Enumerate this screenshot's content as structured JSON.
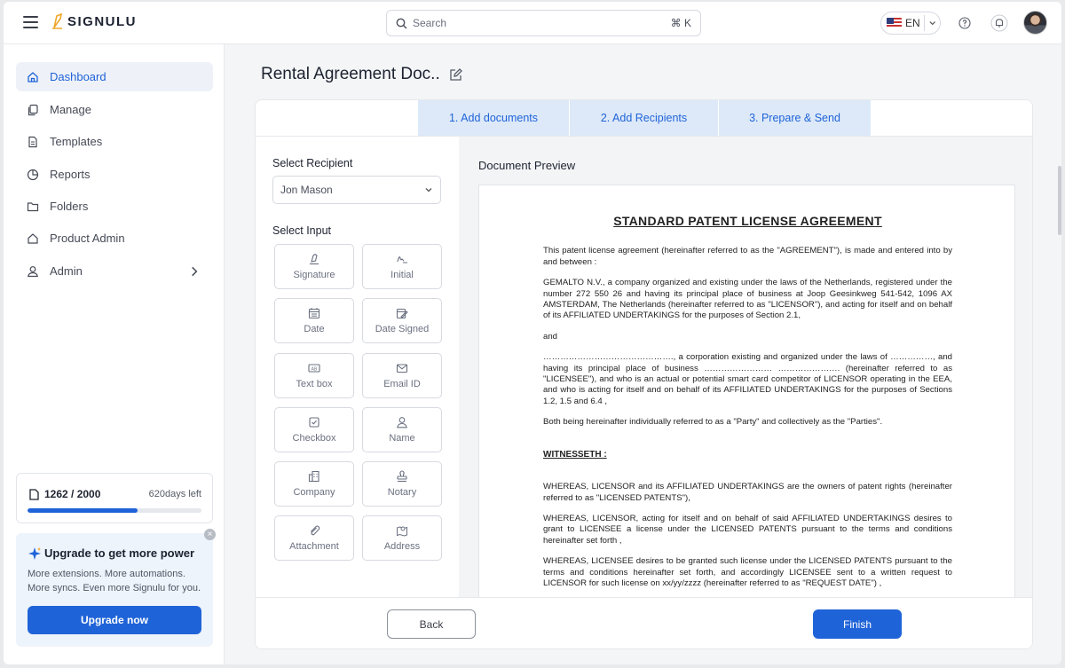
{
  "app": {
    "name": "SIGNULU"
  },
  "search": {
    "placeholder": "Search",
    "shortcut": "⌘ K"
  },
  "language": {
    "code": "EN"
  },
  "sidebar": {
    "items": [
      {
        "label": "Dashboard",
        "icon": "home-icon",
        "active": true
      },
      {
        "label": "Manage",
        "icon": "copy-icon"
      },
      {
        "label": "Templates",
        "icon": "file-icon"
      },
      {
        "label": "Reports",
        "icon": "pie-chart-icon"
      },
      {
        "label": "Folders",
        "icon": "folder-icon"
      },
      {
        "label": "Product Admin",
        "icon": "home-icon"
      },
      {
        "label": "Admin",
        "icon": "user-icon"
      }
    ],
    "usage": {
      "count": "1262 / 2000",
      "days_left": "620days left",
      "progress_fraction": 0.631
    },
    "upgrade": {
      "title": "Upgrade to get more power",
      "text": "More extensions. More automations. More syncs. Even more Signulu for you.",
      "button": "Upgrade now"
    }
  },
  "page": {
    "title": "Rental Agreement Doc.."
  },
  "steps": [
    "1. Add documents",
    "2. Add Recipients",
    "3. Prepare & Send"
  ],
  "panel": {
    "recipient_label": "Select Recipient",
    "recipient_value": "Jon Mason",
    "input_label": "Select Input",
    "inputs": [
      "Signature",
      "Initial",
      "Date",
      "Date Signed",
      "Text box",
      "Email ID",
      "Checkbox",
      "Name",
      "Company",
      "Notary",
      "Attachment",
      "Address"
    ]
  },
  "preview": {
    "title": "Document Preview",
    "doc_title": "STANDARD PATENT LICENSE AGREEMENT",
    "p1": "This patent license agreement (hereinafter referred to as the \"AGREEMENT\"), is made and entered into by and between :",
    "p2": "GEMALTO N.V., a company organized and existing under the laws of the Netherlands, registered under the number 272 550 26 and having its principal place of business at Joop Geesinkweg 541-542, 1096 AX AMSTERDAM, The Netherlands (hereinafter referred to as \"LICENSOR\"), and acting for itself and on behalf of its AFFILIATED UNDERTAKINGS for the purposes of Section 2.1,",
    "p3": "and",
    "p4": "……………………………………….,      a corporation existing and organized under the laws of ……………, and having its principal place of business …………………… …………………. (hereinafter referred to as \"LICENSEE\"), and who is an actual or potential smart card competitor of LICENSOR operating in the EEA, and who is acting for itself and on behalf of its AFFILIATED UNDERTAKINGS for the purposes of Sections 1.2, 1.5 and 6.4 ,",
    "p5": "Both being hereinafter individually referred to as a \"Party\" and collectively as the \"Parties\".",
    "witness": "WITNESSETH :",
    "p6": "WHEREAS, LICENSOR and its AFFILIATED UNDERTAKINGS are the owners of patent rights (hereinafter referred to as \"LICENSED PATENTS\"),",
    "p7": "WHEREAS, LICENSOR, acting for itself and on behalf of said AFFILIATED UNDERTAKINGS desires to grant to LICENSEE a license under the LICENSED PATENTS pursuant to the terms and conditions hereinafter set forth ,",
    "p8": "WHEREAS, LICENSEE desires to be granted such license under the LICENSED PATENTS pursuant to the terms and conditions hereinafter set forth, and accordingly LICENSEE sent to a written request to LICENSOR for such license on xx/yy/zzzz (hereinafter referred to as \"REQUEST DATE\") ,"
  },
  "footer": {
    "back": "Back",
    "finish": "Finish"
  },
  "colors": {
    "accent": "#1f63d8",
    "step_bg": "#dde9f8"
  }
}
